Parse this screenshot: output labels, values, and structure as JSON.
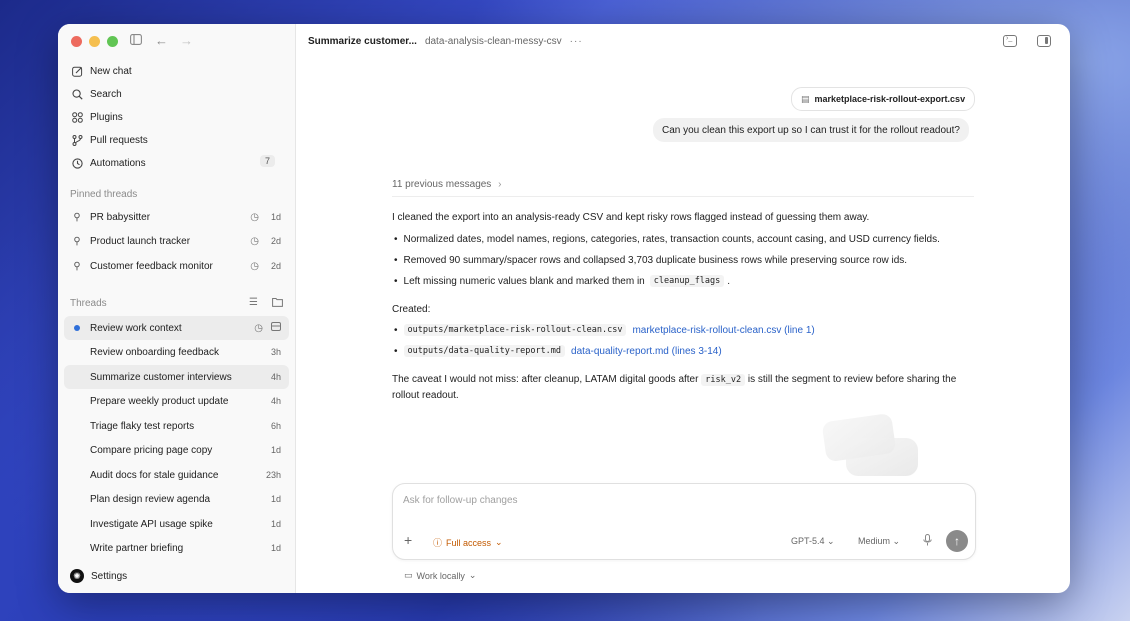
{
  "sidebar": {
    "nav": [
      {
        "label": "New chat",
        "icon": "new-chat-icon"
      },
      {
        "label": "Search",
        "icon": "search-icon"
      },
      {
        "label": "Plugins",
        "icon": "plugins-icon"
      },
      {
        "label": "Pull requests",
        "icon": "pull-request-icon"
      },
      {
        "label": "Automations",
        "icon": "clock-icon",
        "badge": "7"
      }
    ],
    "pinned_label": "Pinned threads",
    "pinned": [
      {
        "title": "PR babysitter",
        "time": "1d"
      },
      {
        "title": "Product launch tracker",
        "time": "2d"
      },
      {
        "title": "Customer feedback monitor",
        "time": "2d"
      }
    ],
    "threads_label": "Threads",
    "threads": [
      {
        "title": "Review work context",
        "time": ""
      },
      {
        "title": "Review onboarding feedback",
        "time": "3h"
      },
      {
        "title": "Summarize customer interviews",
        "time": "4h"
      },
      {
        "title": "Prepare weekly product update",
        "time": "4h"
      },
      {
        "title": "Triage flaky test reports",
        "time": "6h"
      },
      {
        "title": "Compare pricing page copy",
        "time": "1d"
      },
      {
        "title": "Audit docs for stale guidance",
        "time": "23h"
      },
      {
        "title": "Plan design review agenda",
        "time": "1d"
      },
      {
        "title": "Investigate API usage spike",
        "time": "1d"
      },
      {
        "title": "Write partner briefing",
        "time": "1d"
      }
    ],
    "settings_label": "Settings"
  },
  "header": {
    "title": "Summarize customer...",
    "project": "data-analysis-clean-messy-csv",
    "more": "···"
  },
  "chat": {
    "attachment": "marketplace-risk-rollout-export.csv",
    "user_message": "Can you clean this export up so I can trust it for the rollout readout?",
    "previous": "11 previous messages",
    "intro": "I cleaned the export into an analysis-ready CSV and kept risky rows flagged instead of guessing them away.",
    "bullets": [
      "Normalized dates, model names, regions, categories, rates, transaction counts, account casing, and USD currency fields.",
      "Removed 90 summary/spacer rows and collapsed 3,703 duplicate business rows while preserving source row ids.",
      "Left missing numeric values blank and marked them in"
    ],
    "bullet3_code": "cleanup_flags",
    "created_label": "Created:",
    "files": [
      {
        "path": "outputs/marketplace-risk-rollout-clean.csv",
        "link": "marketplace-risk-rollout-clean.csv (line 1)"
      },
      {
        "path": "outputs/data-quality-report.md",
        "link": "data-quality-report.md (lines 3-14)"
      }
    ],
    "caveat_a": "The caveat I would not miss: after cleanup, LATAM digital goods after",
    "caveat_code": "risk_v2",
    "caveat_b": "is still the segment to review before sharing the",
    "caveat_c": "rollout readout."
  },
  "composer": {
    "placeholder": "Ask for follow-up changes",
    "access": "Full access",
    "model": "GPT-5.4",
    "effort": "Medium",
    "work_locally": "Work locally"
  },
  "colors": {
    "accent_link": "#2a62c9",
    "access_warning": "#c35a00",
    "active_dot": "#2f6fd9"
  }
}
